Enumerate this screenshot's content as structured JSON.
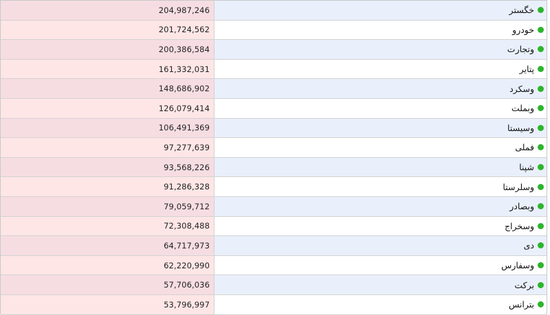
{
  "table": {
    "colors": {
      "indicator": "#2cb52c",
      "value_bg_a": "#f6dde2",
      "value_bg_b": "#ffe6e6",
      "name_bg_a": "#e9f0fb",
      "name_bg_b": "#ffffff"
    },
    "rows": [
      {
        "name": "خگستر",
        "value": "204,987,246"
      },
      {
        "name": "خودرو",
        "value": "201,724,562"
      },
      {
        "name": "وتجارت",
        "value": "200,386,584"
      },
      {
        "name": "پتایر",
        "value": "161,332,031"
      },
      {
        "name": "وسکرد",
        "value": "148,686,902"
      },
      {
        "name": "وبملت",
        "value": "126,079,414"
      },
      {
        "name": "وسیستا",
        "value": "106,491,369"
      },
      {
        "name": "فملی",
        "value": "97,277,639"
      },
      {
        "name": "شپنا",
        "value": "93,568,226"
      },
      {
        "name": "وسلرستا",
        "value": "91,286,328"
      },
      {
        "name": "وبصادر",
        "value": "79,059,712"
      },
      {
        "name": "وسخراج",
        "value": "72,308,488"
      },
      {
        "name": "دی",
        "value": "64,717,973"
      },
      {
        "name": "وسفارس",
        "value": "62,220,990"
      },
      {
        "name": "برکت",
        "value": "57,706,036"
      },
      {
        "name": "بترانس",
        "value": "53,796,997"
      }
    ]
  }
}
